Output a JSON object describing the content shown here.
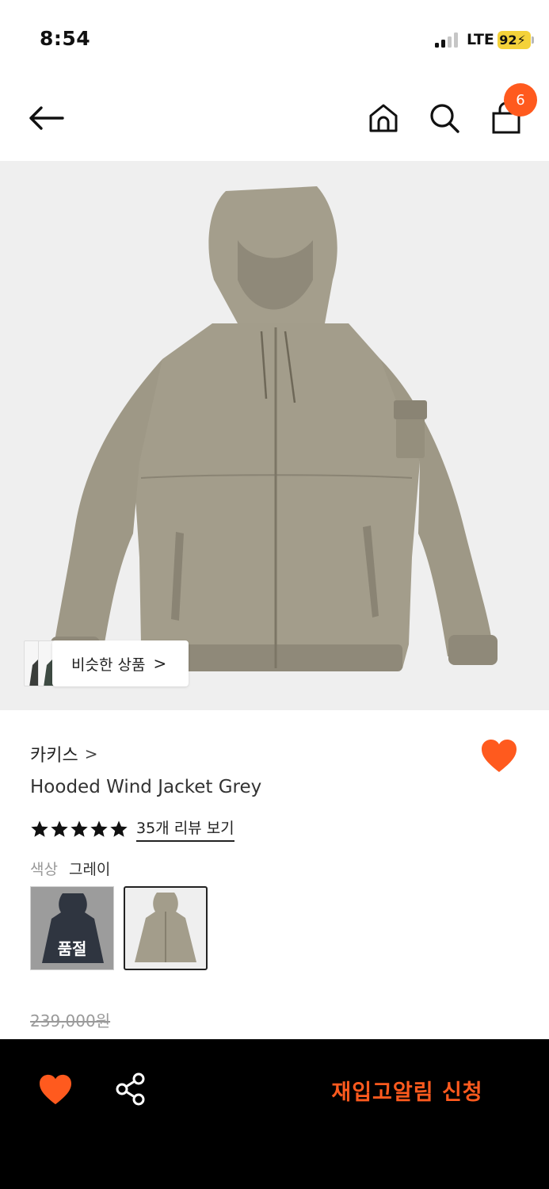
{
  "status_bar": {
    "time": "8:54",
    "network": "LTE",
    "battery": "92"
  },
  "header": {
    "back_icon": "arrow-left-icon",
    "home_icon": "home-icon",
    "search_icon": "search-icon",
    "bag_icon": "shopping-bag-icon",
    "cart_count": "6"
  },
  "product_image": {
    "subject": "hooded-wind-jacket-khaki-grey",
    "similar_label": "비슷한 상품",
    "similar_chevron": ">"
  },
  "product": {
    "brand": "카키스",
    "brand_chevron": ">",
    "name": "Hooded Wind Jacket Grey",
    "rating_stars": 5,
    "review_link": "35개 리뷰 보기",
    "color_label": "색상",
    "color_value": "그레이",
    "swatches": [
      {
        "color_name": "navy",
        "status": "품절"
      },
      {
        "color_name": "grey",
        "status": ""
      }
    ],
    "original_price": "239,000원",
    "wishlisted": true
  },
  "bottom_bar": {
    "wish_icon": "heart-icon",
    "share_icon": "share-icon",
    "restock_button": "재입고알림 신청"
  },
  "colors": {
    "accent": "#ff5a1e",
    "bottom_bar_bg": "#000000",
    "image_bg": "#efefef",
    "jacket": "#a39d8b",
    "battery": "#f4d23a"
  }
}
